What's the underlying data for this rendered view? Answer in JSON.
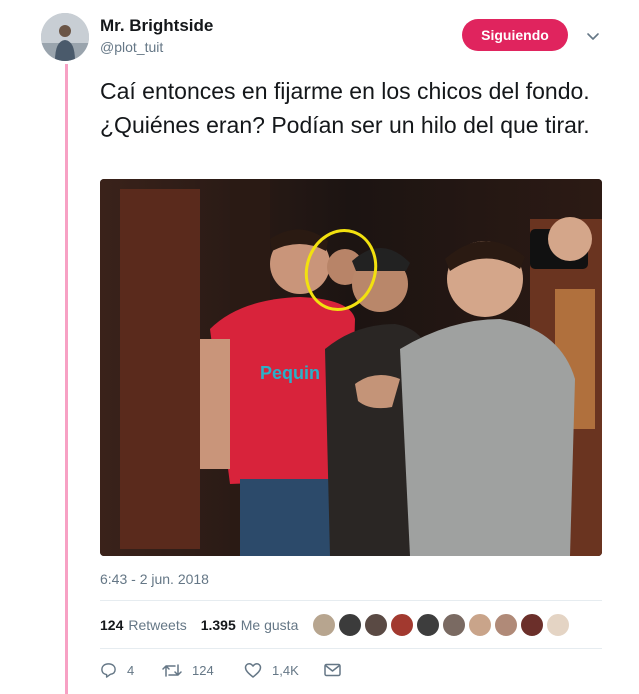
{
  "user": {
    "display_name": "Mr. Brightside",
    "handle": "@plot_tuit",
    "avatar_icon": "avatar"
  },
  "follow_button": {
    "label": "Siguiendo",
    "color": "#e0245e"
  },
  "tweet": {
    "text": "Caí entonces en fijarme en los chicos del fondo. ¿Quiénes eran? Podían ser un hilo del que tirar.",
    "timestamp": "6:43 - 2 jun. 2018"
  },
  "stats": {
    "retweets_count": "124",
    "retweets_label": "Retweets",
    "likes_count": "1.395",
    "likes_label": "Me gusta"
  },
  "actions": {
    "reply_count": "4",
    "retweet_count": "124",
    "like_count": "1,4K"
  },
  "colors": {
    "thread_line": "#f7a1c4",
    "secondary_text": "#657786",
    "annotation_circle": "#f2e10f"
  }
}
